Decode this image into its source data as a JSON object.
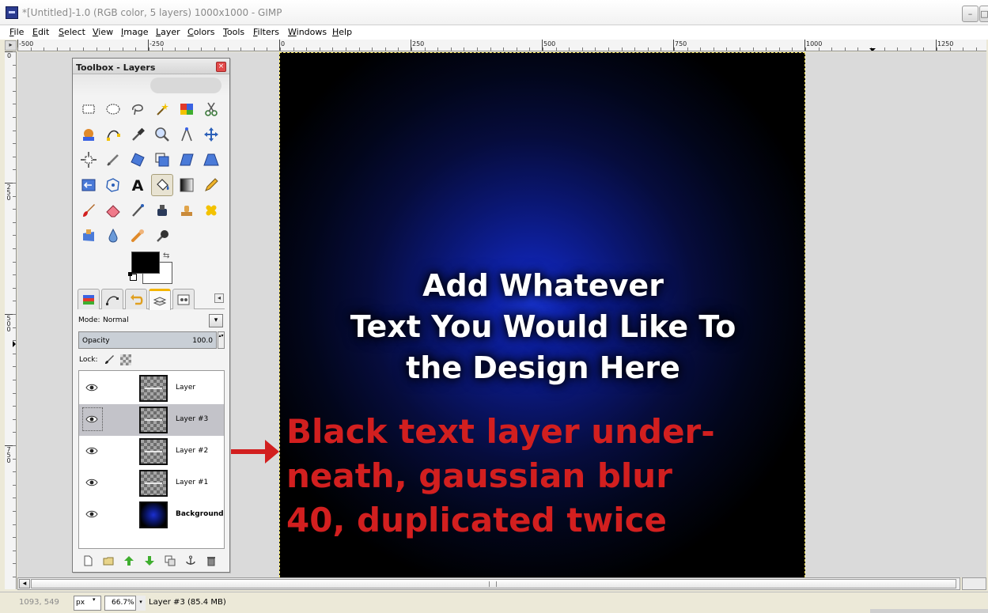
{
  "window": {
    "title": "*[Untitled]-1.0 (RGB color, 5 layers) 1000x1000 - GIMP",
    "minimize_glyph": "–",
    "maximize_glyph": "□"
  },
  "menu": [
    "File",
    "Edit",
    "Select",
    "View",
    "Image",
    "Layer",
    "Colors",
    "Tools",
    "Filters",
    "Windows",
    "Help"
  ],
  "ruler": {
    "horizontal_labels": [
      "-500",
      "-250",
      "0",
      "250",
      "500",
      "750",
      "1000",
      "1250"
    ],
    "vertical_labels": [
      "0",
      "250",
      "500",
      "750"
    ],
    "corner_glyph": "▸"
  },
  "canvas": {
    "text_lines": [
      "Add Whatever",
      "Text You Would Like To",
      "the Design Here"
    ]
  },
  "annotation": {
    "lines": [
      "Black text layer under-",
      "neath, gaussian blur",
      "40, duplicated twice"
    ],
    "color": "#d21f1f"
  },
  "toolbox": {
    "title": "Toolbox - Layers",
    "close_glyph": "×",
    "fg_color": "#000000",
    "bg_color": "#ffffff",
    "swap_glyph": "⇆",
    "dock_menu_glyph": "◂",
    "mode_label": "Mode:",
    "mode_value": "Normal",
    "mode_glyph": "▾",
    "opacity_label": "Opacity",
    "opacity_value": "100.0",
    "opacity_spin_glyph": "▴▾",
    "lock_label": "Lock:"
  },
  "layers": [
    {
      "name": "Layer",
      "selected": false,
      "background": false
    },
    {
      "name": "Layer #3",
      "selected": true,
      "background": false
    },
    {
      "name": "Layer #2",
      "selected": false,
      "background": false
    },
    {
      "name": "Layer #1",
      "selected": false,
      "background": false
    },
    {
      "name": "Background",
      "selected": false,
      "background": true
    }
  ],
  "scrollbar": {
    "left_glyph": "◂"
  },
  "status": {
    "coords": "1093, 549",
    "unit": "px",
    "unit_glyph": "▾",
    "zoom": "66.7%",
    "zoom_glyph": "▾",
    "layer_info": "Layer #3 (85.4 MB)"
  }
}
